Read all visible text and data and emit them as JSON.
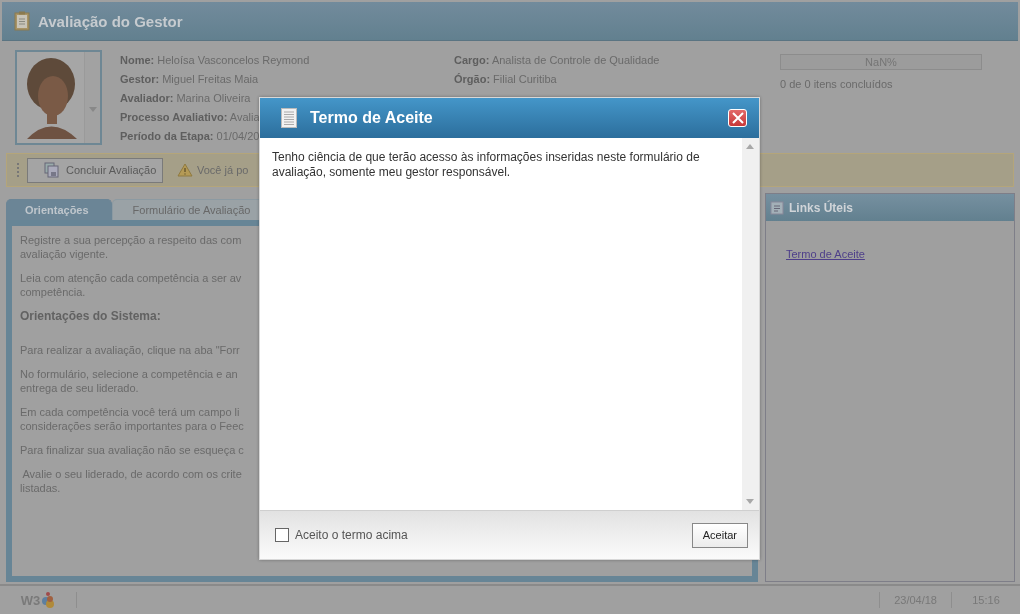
{
  "page_title": "Avaliação do Gestor",
  "profile": {
    "fields_left": [
      "**Nome:** Heloísa Vasconcelos Reymond",
      "**Gestor:** Miguel Freitas Maia",
      "**Avaliador:** Marina Oliveira",
      "**Processo Avaliativo:** Avalia",
      "**Período da Etapa:** 01/04/20"
    ],
    "fields_right": [
      "**Cargo:** Analista de Controle de Qualidade",
      "**Órgão:** Filial Curitiba"
    ]
  },
  "progress": {
    "level": 0,
    "reading": "NaN%",
    "summary": "0 de 0 itens concluídos"
  },
  "toolbar": {
    "button": "Concluir Avaliação",
    "warning": "Você já po"
  },
  "tabs": [
    {
      "label": "Orientações",
      "selected": true
    },
    {
      "label": "Formulário de Avaliação",
      "selected": false
    }
  ],
  "guidance": [
    {
      "kind": "paragraph",
      "lines": [
        "Registre a sua percepção a respeito das com",
        "avaliação vigente."
      ]
    },
    {
      "kind": "paragraph",
      "lines": [
        "Leia com atenção cada competência a ser av",
        "competência."
      ]
    },
    {
      "kind": "heading",
      "lines": [
        "Orientações do Sistema:"
      ]
    },
    {
      "kind": "paragraph",
      "lines": [
        "Para realizar a avaliação, clique na aba \"Forr"
      ]
    },
    {
      "kind": "paragraph",
      "lines": [
        "No formulário, selecione a competência e an",
        "entrega de seu liderado."
      ]
    },
    {
      "kind": "paragraph",
      "lines": [
        "Em cada competência você terá um campo li",
        "considerações serão importantes para o Feec"
      ]
    },
    {
      "kind": "paragraph",
      "lines": [
        "Para finalizar sua avaliação não se esqueça c"
      ]
    },
    {
      "kind": "paragraph",
      "lines": [
        " Avalie o seu liderado, de acordo com os crite",
        "listadas."
      ]
    }
  ],
  "links_panel": {
    "title": "Links Úteis",
    "links": [
      "Termo de Aceite"
    ]
  },
  "status_bar": {
    "logo": "W3",
    "date": "23/04/18",
    "time": "15:16"
  },
  "dialog": {
    "title": "Termo de Aceite",
    "text": "Tenho ciência de que terão acesso às informações inseridas neste formulário de avaliação, somente meu gestor responsável.",
    "checkbox": {
      "label": "Aceito o termo acima",
      "checked": false
    },
    "button": "Aceitar"
  }
}
